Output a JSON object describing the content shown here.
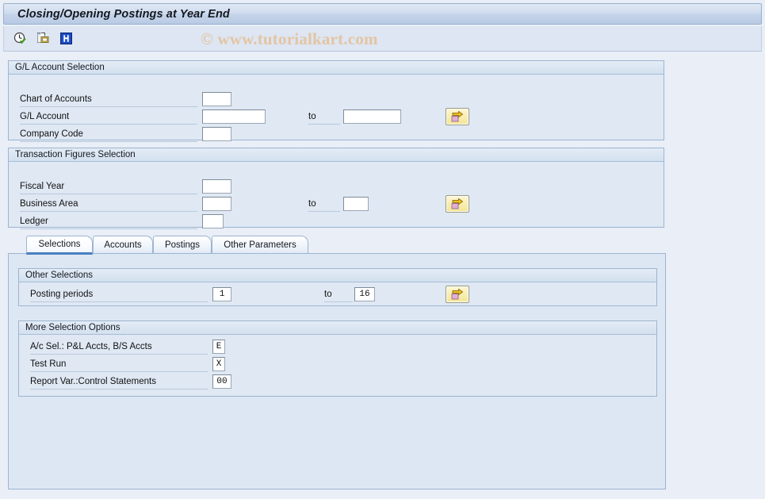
{
  "window": {
    "title": "Closing/Opening Postings at Year End"
  },
  "watermark": {
    "text": "© www.tutorialkart.com"
  },
  "toolbar": {
    "buttons": [
      {
        "name": "execute-clock-icon",
        "tooltip": "Execute"
      },
      {
        "name": "get-variant-icon",
        "tooltip": "Get Variant"
      },
      {
        "name": "info-icon",
        "tooltip": "Information"
      }
    ]
  },
  "gl_account_selection": {
    "header": "G/L Account Selection",
    "fields": [
      {
        "label": "Chart of Accounts",
        "value": "",
        "to_label": null,
        "to_value": null,
        "multi": false
      },
      {
        "label": "G/L Account",
        "value": "",
        "to_label": "to",
        "to_value": "",
        "multi": true
      },
      {
        "label": "Company Code",
        "value": "",
        "to_label": null,
        "to_value": null,
        "multi": false
      }
    ]
  },
  "transaction_figures_selection": {
    "header": "Transaction Figures Selection",
    "fields": [
      {
        "label": "Fiscal Year",
        "value": "",
        "to_label": null,
        "to_value": null,
        "multi": false
      },
      {
        "label": "Business Area",
        "value": "",
        "to_label": "to",
        "to_value": "",
        "multi": true
      },
      {
        "label": "Ledger",
        "value": "",
        "to_label": null,
        "to_value": null,
        "multi": false
      }
    ]
  },
  "tabs": [
    {
      "label": "Selections",
      "active": true
    },
    {
      "label": "Accounts",
      "active": false
    },
    {
      "label": "Postings",
      "active": false
    },
    {
      "label": "Other Parameters",
      "active": false
    }
  ],
  "other_selections": {
    "header": "Other Selections",
    "fields": [
      {
        "label": "Posting periods",
        "value": "1",
        "to_label": "to",
        "to_value": "16",
        "multi": true
      }
    ]
  },
  "more_selection_options": {
    "header": "More Selection Options",
    "fields": [
      {
        "label": "A/c Sel.: P&L Accts, B/S Accts",
        "value": "E"
      },
      {
        "label": "Test Run",
        "value": "X"
      },
      {
        "label": "Report Var.:Control Statements",
        "value": "00"
      }
    ]
  },
  "colors": {
    "page_background": "#e9eef7",
    "panel_background": "#dfe8f3",
    "panel_border": "#9db4d1",
    "title_text": "#14181f",
    "accent_tab": "#4a7fc1",
    "button_yellow": "#f3e596",
    "watermark": "#e6bf96"
  }
}
